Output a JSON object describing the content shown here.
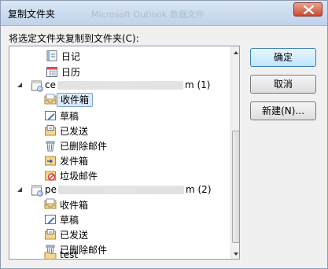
{
  "window": {
    "title": "复制文件夹",
    "background_title": "Microsoft Outlook 数据文件"
  },
  "instruction": "将选定文件夹复制到文件夹(C):",
  "tree": {
    "items": [
      {
        "label": "日记",
        "icon": "journal-icon"
      },
      {
        "label": "日历",
        "icon": "calendar-icon"
      },
      {
        "label_prefix": "ce",
        "label_suffix": "m (1)",
        "icon": "data-file-icon",
        "expanded": true
      },
      {
        "label": "收件箱",
        "icon": "inbox-icon",
        "selected": true
      },
      {
        "label": "草稿",
        "icon": "drafts-icon"
      },
      {
        "label": "已发送",
        "icon": "sent-icon"
      },
      {
        "label": "已删除邮件",
        "icon": "deleted-icon"
      },
      {
        "label": "发件箱",
        "icon": "outbox-icon"
      },
      {
        "label": "垃圾邮件",
        "icon": "junk-icon"
      },
      {
        "label_prefix": "pe",
        "label_suffix": "m (2)",
        "icon": "data-file-icon",
        "expanded": true
      },
      {
        "label": "收件箱",
        "icon": "inbox-icon"
      },
      {
        "label": "草稿",
        "icon": "drafts-icon"
      },
      {
        "label": "已发送",
        "icon": "sent-icon"
      },
      {
        "label": "已删除邮件",
        "icon": "deleted-icon"
      },
      {
        "label": "test",
        "icon": "folder-icon"
      }
    ]
  },
  "buttons": {
    "ok": "确定",
    "cancel": "取消",
    "new": "新建(N)..."
  },
  "colors": {
    "selection_bg": "#dbeaf9",
    "selection_border": "#7da2ce",
    "primary_button_border": "#3c7fb1",
    "close_button": "#cd4a34"
  }
}
